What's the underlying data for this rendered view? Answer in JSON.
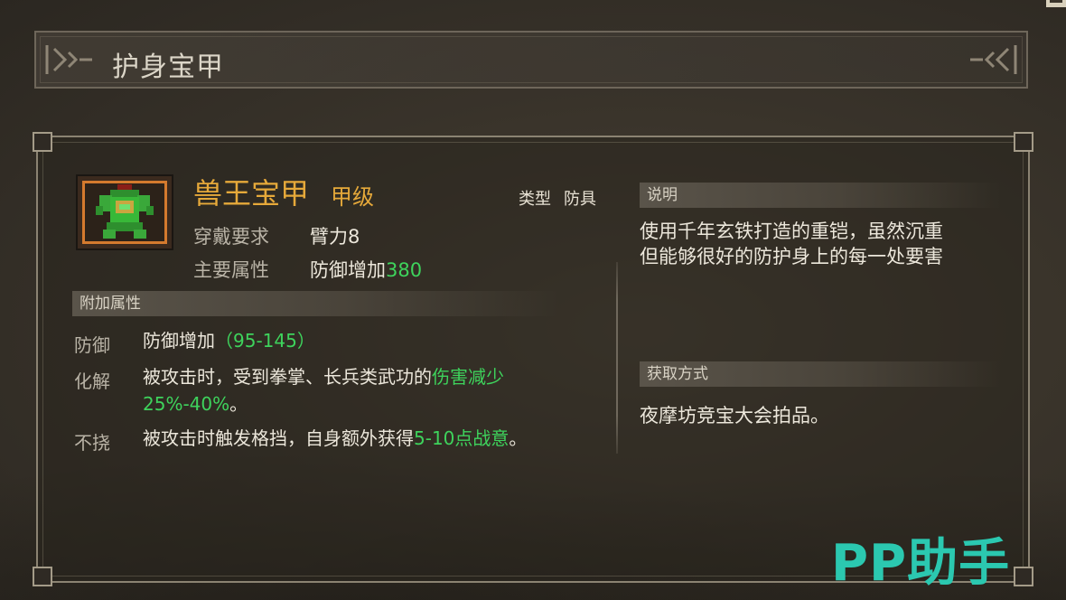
{
  "page_title": "护身宝甲",
  "item": {
    "name": "兽王宝甲",
    "grade": "甲级",
    "type_label": "类型",
    "type_value": "防具",
    "requirement_label": "穿戴要求",
    "requirement_value": "臂力8",
    "main_attr_label": "主要属性",
    "main_attr_prefix": "防御增加",
    "main_attr_value": "380",
    "icon": "green-armor-icon"
  },
  "extra_attrs": {
    "header": "附加属性",
    "rows": [
      {
        "label": "防御",
        "text": "防御增加",
        "highlight": "（95-145）"
      },
      {
        "label": "化解",
        "text": "被攻击时，受到拳掌、长兵类武功的",
        "highlight": "伤害减少",
        "line2": "25%-40%",
        "suffix": "。"
      },
      {
        "label": "不挠",
        "text": "被攻击时触发格挡，自身额外获得",
        "highlight": "5-10点战意",
        "suffix": "。"
      }
    ]
  },
  "description": {
    "header": "说明",
    "line1": "使用千年玄铁打造的重铠，虽然沉重",
    "line2": "但能够很好的防护身上的每一处要害"
  },
  "source": {
    "header": "获取方式",
    "text": "夜摩坊竞宝大会拍品。"
  },
  "watermark": "PP助手",
  "colors": {
    "accent_gold": "#e6a93a",
    "highlight_green": "#3ed35c",
    "frame_orange": "#d47a2e",
    "watermark_teal": "#2bc8b0"
  }
}
